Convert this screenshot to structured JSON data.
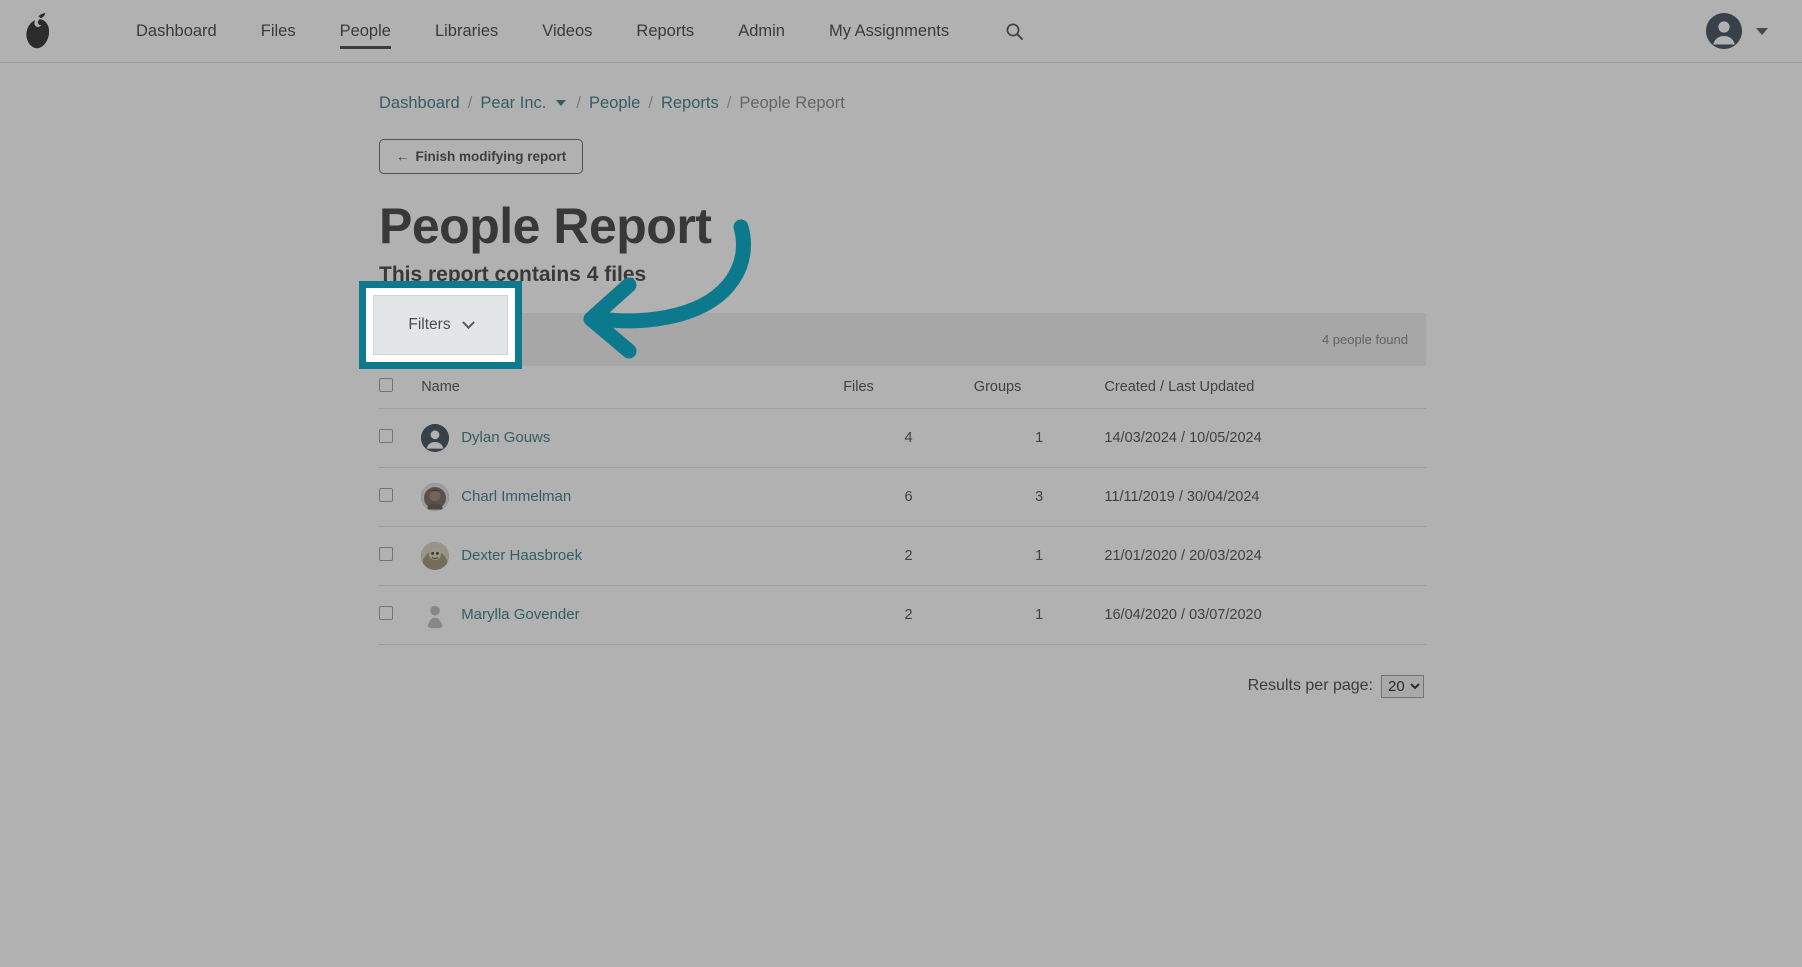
{
  "topnav": {
    "logo_icon": "pear-logo-icon",
    "links": [
      {
        "label": "Dashboard",
        "active": false
      },
      {
        "label": "Files",
        "active": false
      },
      {
        "label": "People",
        "active": true
      },
      {
        "label": "Libraries",
        "active": false
      },
      {
        "label": "Videos",
        "active": false
      },
      {
        "label": "Reports",
        "active": false
      },
      {
        "label": "Admin",
        "active": false
      },
      {
        "label": "My Assignments",
        "active": false
      }
    ],
    "search_icon": "search-icon",
    "avatar_icon": "user-avatar-icon",
    "account_caret_icon": "chevron-down-icon"
  },
  "breadcrumb": {
    "items": [
      {
        "label": "Dashboard",
        "type": "link"
      },
      {
        "label": "/",
        "type": "sep"
      },
      {
        "label": "Pear Inc.",
        "type": "link_with_caret"
      },
      {
        "label": "/",
        "type": "sep"
      },
      {
        "label": "People",
        "type": "link"
      },
      {
        "label": "/",
        "type": "sep"
      },
      {
        "label": "Reports",
        "type": "link"
      },
      {
        "label": "/",
        "type": "sep"
      },
      {
        "label": "People Report",
        "type": "current"
      }
    ],
    "crumb_0": "Dashboard",
    "crumb_1": "Pear Inc.",
    "crumb_2": "People",
    "crumb_3": "Reports",
    "crumb_4": "People Report",
    "sep": "/"
  },
  "actions": {
    "finish_modifying_label": "Finish modifying report",
    "finish_modifying_arrow": "←"
  },
  "header": {
    "title": "People Report",
    "subtitle": "This report contains 4 files"
  },
  "toolbar": {
    "filters_label": "Filters",
    "filters_chevron_icon": "chevron-down-icon",
    "found_text": "4 people found"
  },
  "table": {
    "columns": [
      "Name",
      "Files",
      "Groups",
      "Created / Last Updated"
    ],
    "col_name": "Name",
    "col_files": "Files",
    "col_groups": "Groups",
    "col_dates": "Created / Last Updated",
    "rows": [
      {
        "name": "Dylan Gouws",
        "files": "4",
        "groups": "1",
        "dates": "14/03/2024 / 10/05/2024",
        "avatar_style": "navy"
      },
      {
        "name": "Charl Immelman",
        "files": "6",
        "groups": "3",
        "dates": "11/11/2019 / 30/04/2024",
        "avatar_style": "photo1"
      },
      {
        "name": "Dexter Haasbroek",
        "files": "2",
        "groups": "1",
        "dates": "21/01/2020 / 20/03/2024",
        "avatar_style": "photo2"
      },
      {
        "name": "Marylla Govender",
        "files": "2",
        "groups": "1",
        "dates": "16/04/2020 / 03/07/2020",
        "avatar_style": "ghost"
      }
    ]
  },
  "footer": {
    "results_per_page_label": "Results per page:",
    "results_per_page_value": "20",
    "results_per_page_options": [
      "20"
    ]
  },
  "annotation": {
    "highlight_color": "#0c7a8c",
    "arrow_color": "#0c7a8c",
    "target": "filters-button"
  }
}
